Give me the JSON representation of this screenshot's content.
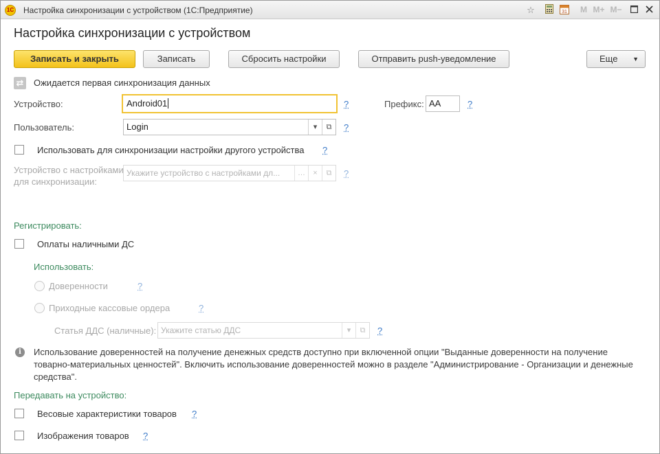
{
  "window": {
    "title": "Настройка синхронизации с устройством  (1С:Предприятие)",
    "logo_text": "1С",
    "toolbar_icons": [
      "star-icon",
      "calculator-icon",
      "calendar-icon"
    ],
    "calendar_day": "31",
    "memory_buttons": [
      "M",
      "M+",
      "M−"
    ]
  },
  "page": {
    "title": "Настройка синхронизации с устройством"
  },
  "actions": {
    "save_close": "Записать и закрыть",
    "save": "Записать",
    "reset": "Сбросить настройки",
    "push": "Отправить push-уведомление",
    "more": "Еще"
  },
  "status": {
    "text": "Ожидается первая синхронизация данных"
  },
  "form": {
    "device_label": "Устройство:",
    "device_value": "Android01",
    "prefix_label": "Префикс:",
    "prefix_value": "АА",
    "user_label": "Пользователь:",
    "user_value": "Login",
    "use_other_label": "Использовать для синхронизации настройки другого устройства",
    "source_device_label_1": "Устройство с настройками",
    "source_device_label_2": "для синхронизации:",
    "source_device_placeholder": "Укажите устройство с настройками дл...",
    "help": "?"
  },
  "register": {
    "section_title": "Регистрировать:",
    "cash_payments_label": "Оплаты наличными ДС",
    "use_title": "Использовать:",
    "option_poa": "Доверенности",
    "option_receipts": "Приходные кассовые ордера",
    "cashflow_label": "Статья ДДС (наличные):",
    "cashflow_placeholder": "Укажите статью ДДС"
  },
  "info": {
    "text": "Использование доверенностей на получение денежных средств доступно при включенной опции \"Выданные доверенности на получение товарно-материальных ценностей\". Включить использование доверенностей можно в разделе \"Администрирование - Организации и денежные средства\"."
  },
  "transfer": {
    "section_title": "Передавать на устройство:",
    "weight_label": "Весовые характеристики товаров",
    "images_label": "Изображения товаров"
  }
}
